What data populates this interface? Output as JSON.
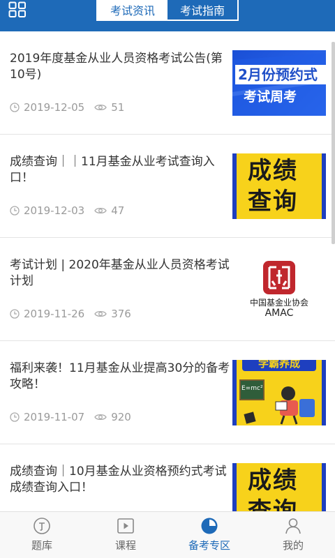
{
  "header": {
    "tabs": [
      {
        "label": "考试资讯",
        "active": true
      },
      {
        "label": "考试指南",
        "active": false
      }
    ]
  },
  "articles": [
    {
      "title": "2019年度基金从业人员资格考试公告(第10号)",
      "date": "2019-12-05",
      "views": "51",
      "thumb_text": [
        "2月份预约式",
        "考试周考"
      ]
    },
    {
      "title": "成绩查询｜｜11月基金从业考试查询入口！",
      "date": "2019-12-03",
      "views": "47",
      "thumb_text": [
        "成绩",
        "查询"
      ]
    },
    {
      "title": "考试计划 | 2020年基金从业人员资格考试计划",
      "date": "2019-11-26",
      "views": "376",
      "thumb_text": [
        "中国基金业协会",
        "AMAC"
      ]
    },
    {
      "title": "福利来袭！11月基金从业提高30分的备考攻略！",
      "date": "2019-11-07",
      "views": "920",
      "thumb_text": [
        "学霸养成",
        "E=mc²"
      ]
    },
    {
      "title": "成绩查询｜10月基金从业资格预约式考试成绩查询入口！",
      "date": "",
      "views": "",
      "thumb_text": [
        "成绩",
        "查询"
      ]
    }
  ],
  "bottom_nav": [
    {
      "label": "题库",
      "icon": "pin-circle-icon",
      "active": false
    },
    {
      "label": "课程",
      "icon": "play-icon",
      "active": false
    },
    {
      "label": "备考专区",
      "icon": "pie-clock-icon",
      "active": true
    },
    {
      "label": "我的",
      "icon": "person-icon",
      "active": false
    }
  ],
  "colors": {
    "brand": "#1e6ab8",
    "text": "#333333",
    "meta": "#9a9a9a",
    "yellow": "#f7d21b",
    "amac_red": "#c0272d"
  }
}
